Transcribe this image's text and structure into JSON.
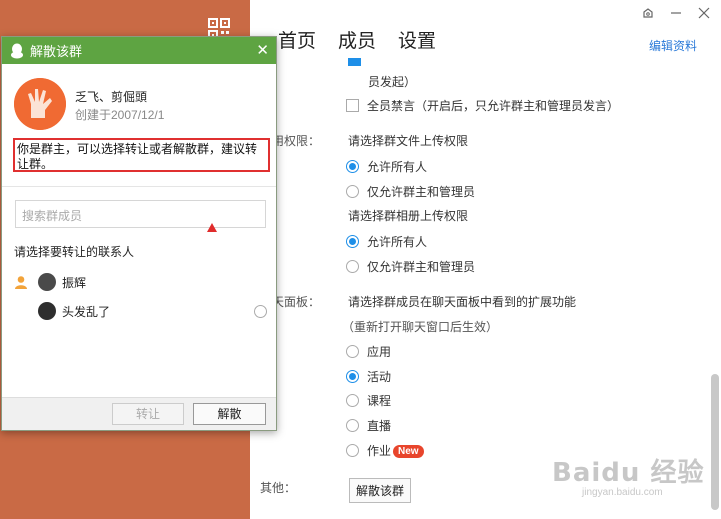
{
  "nav": {
    "items": [
      "首页",
      "成员",
      "设置"
    ],
    "edit_label": "编辑资料"
  },
  "settings": {
    "top_partial": "员发起）",
    "mute_all": {
      "label": "全员禁言（开启后，只允许群主和管理员发言）",
      "checked": false
    },
    "upload_section_label": "用权限：",
    "file_upload": {
      "title": "请选择群文件上传权限",
      "options": [
        "允许所有人",
        "仅允许群主和管理员"
      ],
      "selected": 0
    },
    "album_upload": {
      "title": "请选择群相册上传权限",
      "options": [
        "允许所有人",
        "仅允许群主和管理员"
      ],
      "selected": 0
    },
    "panel_section_label": "天面板：",
    "panel": {
      "title": "请选择群成员在聊天面板中看到的扩展功能",
      "note": "（重新打开聊天窗口后生效）",
      "options": [
        "应用",
        "活动",
        "课程",
        "直播",
        "作业"
      ],
      "selected": 1,
      "new_badge": "New"
    },
    "other_label": "其他：",
    "dissolve_button": "解散该群"
  },
  "dialog": {
    "title": "解散该群",
    "group_name": "乏飞、剪倔頭",
    "created": "创建于2007/12/1",
    "notice": "你是群主，可以选择转让或者解散群，建议转让群。",
    "search_placeholder": "搜索群成员",
    "choose_label": "请选择要转让的联系人",
    "members": [
      "振辉",
      "头发乱了"
    ],
    "transfer_button": "转让",
    "dissolve_button": "解散"
  },
  "watermark": {
    "main": "Baidu 经验",
    "sub": "jingyan.baidu.com"
  },
  "colors": {
    "left_panel": "#c96a45",
    "title_bar": "#5ea442",
    "accent": "#1e8fe8",
    "highlight_box": "#e03030",
    "badge": "#e8452c"
  },
  "icons": [
    "qr-code-icon",
    "skin-icon",
    "minimize-icon",
    "close-icon",
    "qq-penguin-icon",
    "owner-icon"
  ]
}
